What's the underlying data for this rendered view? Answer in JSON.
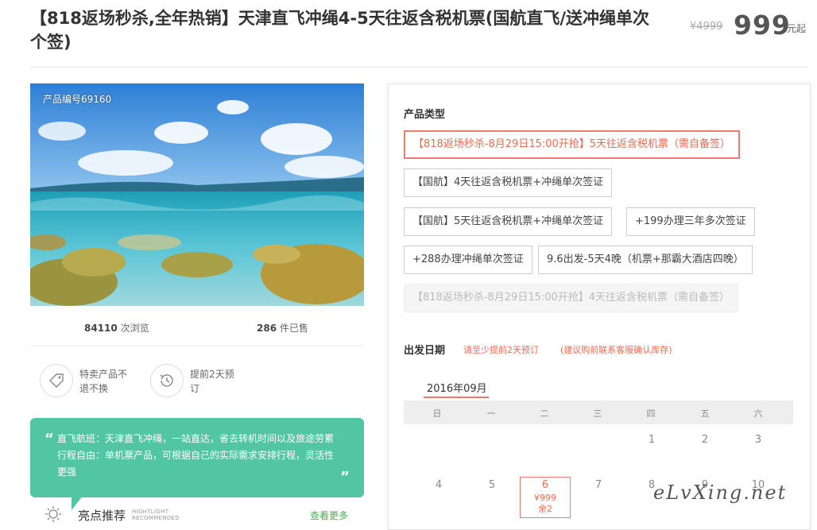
{
  "header": {
    "title": "【818返场秒杀,全年热销】天津直飞冲绳4-5天往返含税机票(国航直飞/送冲绳单次个签)",
    "old_price": "¥4999",
    "price": "999",
    "price_unit": "元起"
  },
  "product": {
    "product_no": "产品编号69160",
    "views_count": "84110",
    "views_label": "次浏览",
    "sold_count": "286",
    "sold_label": "件已售"
  },
  "badges": [
    {
      "icon": "tag-icon",
      "text": "特卖产品不退不换"
    },
    {
      "icon": "clock-back-icon",
      "text": "提前2天预订"
    }
  ],
  "highlight_box": {
    "text": "直飞航班：天津直飞冲绳，一站直达，省去转机时间以及旅途劳累行程自由：单机票产品，可根据自己的实际需求安排行程，灵活性更强",
    "open_quote": "“",
    "close_quote": "”"
  },
  "highlights": {
    "title": "亮点推荐",
    "en_line1": "HIGHTLIGHT",
    "en_line2": "RECOMMENDED",
    "more": "查看更多"
  },
  "product_types": {
    "title": "产品类型",
    "options": [
      {
        "label": "【818返场秒杀-8月29日15:00开抢】5天往返含税机票（需自备签）",
        "state": "selected"
      },
      {
        "label": "【国航】4天往返含税机票+冲绳单次签证",
        "state": "normal"
      },
      {
        "label": "【国航】5天往返含税机票+冲绳单次签证",
        "state": "normal"
      },
      {
        "label": "+199办理三年多次签证",
        "state": "normal"
      },
      {
        "label": "+288办理冲绳单次签证",
        "state": "normal"
      },
      {
        "label": "9.6出发-5天4晚（机票+那霸大酒店四晚）",
        "state": "normal"
      },
      {
        "label": "【818返场秒杀-8月29日15:00开抢】4天往返含税机票（需自备签）",
        "state": "disabled"
      }
    ]
  },
  "departure": {
    "title": "出发日期",
    "note1": "请至少提前2天预订",
    "note2": "(建议购前联系客服确认库存)",
    "month": "2016年09月",
    "weekdays": [
      "日",
      "一",
      "二",
      "三",
      "四",
      "五",
      "六"
    ],
    "row1": [
      "1",
      "2",
      "3"
    ],
    "row2": [
      "4",
      "5",
      "7",
      "8",
      "9",
      "10"
    ],
    "selected_day": {
      "day": "6",
      "price": "¥999",
      "stock": "余2"
    }
  },
  "watermark": "eLvXing.net",
  "colors": {
    "accent": "#f06a4f",
    "green": "#52c6a2"
  }
}
